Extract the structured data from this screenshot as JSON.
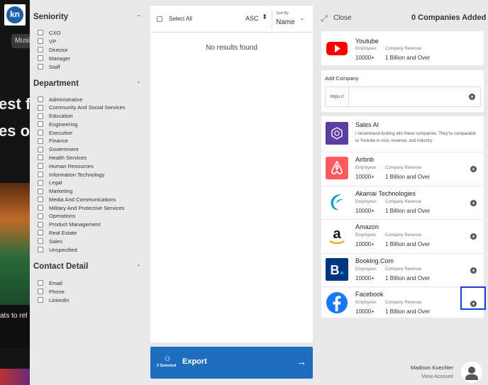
{
  "background": {
    "logo": "kn",
    "pill": "Musi",
    "hero_lines": [
      "est f",
      "es or"
    ],
    "caption": "ats to rel"
  },
  "filters": {
    "sections": [
      {
        "title": "Seniority",
        "options": [
          "CXO",
          "VP",
          "Director",
          "Manager",
          "Staff"
        ]
      },
      {
        "title": "Department",
        "options": [
          "Administrative",
          "Community And Social Services",
          "Education",
          "Engineering",
          "Executive",
          "Finance",
          "Government",
          "Health Services",
          "Human Resources",
          "Information Technology",
          "Legal",
          "Marketing",
          "Media And Communications",
          "Military And Protective Services",
          "Operations",
          "Product Management",
          "Real Estate",
          "Sales",
          "Unspecified"
        ]
      },
      {
        "title": "Contact Detail",
        "options": [
          "Email",
          "Phone",
          "LinkedIn"
        ]
      }
    ]
  },
  "results": {
    "select_all": "Select All",
    "order": "ASC",
    "sort_label": "Sort By",
    "sort_value": "Name",
    "empty_text": "No results found"
  },
  "export": {
    "label": "Export",
    "selected": "0 Selected"
  },
  "right": {
    "close": "Close",
    "added": "0 Companies Added",
    "add_company": {
      "title": "Add Company",
      "protocol": "https://",
      "value": ""
    },
    "labels": {
      "employees": "Employees",
      "revenue": "Company Revenue"
    },
    "selected_company": {
      "name": "Youtube",
      "employees": "10000+",
      "revenue": "1 Billion and Over",
      "color": "#ff0000",
      "icon": "youtube-icon"
    },
    "sales_ai": {
      "name": "Sales AI",
      "description": "I recommend looking into these companies. They're comparable to Youtube in size, revenue, and industry."
    },
    "suggestions": [
      {
        "name": "Airbnb",
        "employees": "10000+",
        "revenue": "1 Billion and Over",
        "color": "#ff5a5f",
        "icon": "airbnb-icon"
      },
      {
        "name": "Akamai Technologies",
        "employees": "10000+",
        "revenue": "1 Billion and Over",
        "color": "#0099cc",
        "icon": "akamai-icon"
      },
      {
        "name": "Amazon",
        "employees": "10000+",
        "revenue": "1 Billion and Over",
        "color": "#ff9900",
        "icon": "amazon-icon"
      },
      {
        "name": "Booking.Com",
        "employees": "10000+",
        "revenue": "1 Billion and Over",
        "color": "#003580",
        "icon": "booking-icon"
      },
      {
        "name": "Facebook",
        "employees": "10000+",
        "revenue": "1 Billion and Over",
        "color": "#1877f2",
        "icon": "facebook-icon"
      }
    ]
  },
  "user": {
    "name": "Madison Kuechler",
    "action": "View Account"
  }
}
